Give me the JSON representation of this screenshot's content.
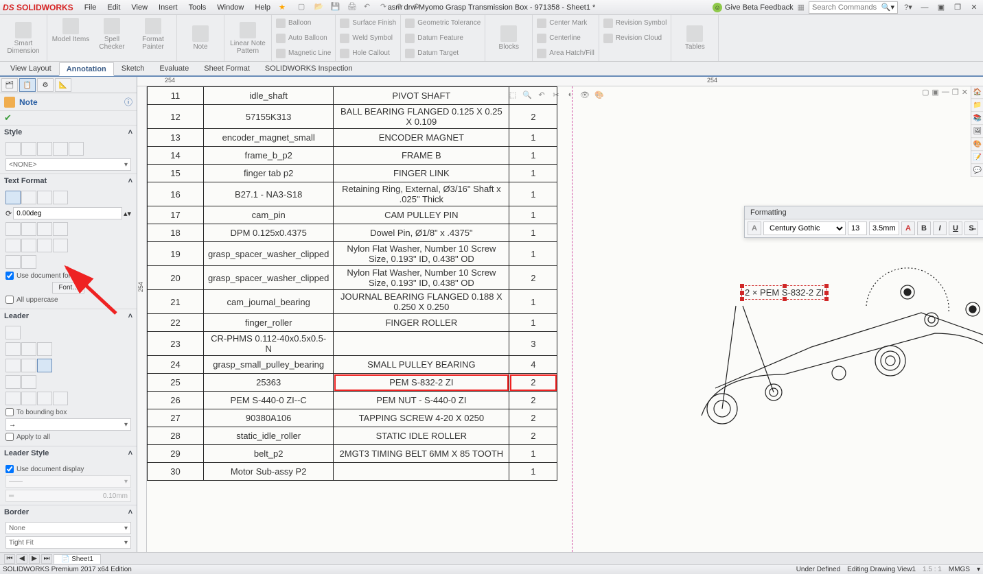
{
  "app": {
    "logo": "SOLIDWORKS"
  },
  "menubar": [
    "File",
    "Edit",
    "View",
    "Insert",
    "Tools",
    "Window",
    "Help"
  ],
  "doc_title": "asm drw-Myomo Grasp Transmission Box - 971358 - Sheet1 *",
  "beta_label": "Give Beta Feedback",
  "search_placeholder": "Search Commands",
  "ribbon": {
    "groups": [
      [
        "Smart Dimension"
      ],
      [
        "Model Items",
        "Spell Checker",
        "Format Painter"
      ],
      [
        "Note"
      ],
      [
        "Linear Note Pattern"
      ],
      [
        [
          "Balloon",
          "Auto Balloon",
          "Magnetic Line"
        ]
      ],
      [
        [
          "Surface Finish",
          "Weld Symbol",
          "Hole Callout"
        ]
      ],
      [
        [
          "Geometric Tolerance",
          "Datum Feature",
          "Datum Target"
        ]
      ],
      [
        "Blocks"
      ],
      [
        [
          "Center Mark",
          "Centerline",
          "Area Hatch/Fill"
        ]
      ],
      [
        [
          "Revision Symbol",
          "Revision Cloud",
          ""
        ]
      ],
      [
        "Tables"
      ]
    ]
  },
  "cmdtabs": [
    "View Layout",
    "Annotation",
    "Sketch",
    "Evaluate",
    "Sheet Format",
    "SOLIDWORKS Inspection"
  ],
  "cmdtabs_active": 1,
  "panel": {
    "note_label": "Note",
    "sections": {
      "style": "Style",
      "style_value": "<NONE>",
      "textformat": "Text Format",
      "angle": "0.00deg",
      "use_doc_font": "Use document font",
      "font_btn": "Font...",
      "all_upper": "All uppercase",
      "leader": "Leader",
      "to_bounding": "To bounding box",
      "apply_all": "Apply to all",
      "leader_style": "Leader Style",
      "use_doc_display": "Use document display",
      "thickness": "0.10mm",
      "border": "Border",
      "border_none": "None",
      "border_fit": "Tight Fit"
    }
  },
  "ruler_marks": {
    "top": "254",
    "left": "254"
  },
  "formatting": {
    "title": "Formatting",
    "font": "Century Gothic",
    "size": "13",
    "height": "3.5mm"
  },
  "note_text": "2 × PEM S-832-2 ZI",
  "bom_rows": [
    {
      "no": "11",
      "pn": "idle_shaft",
      "desc": "PIVOT SHAFT",
      "qty": ""
    },
    {
      "no": "12",
      "pn": "57155K313",
      "desc": "BALL BEARING FLANGED 0.125 X 0.25 X 0.109",
      "qty": "2"
    },
    {
      "no": "13",
      "pn": "encoder_magnet_small",
      "desc": "ENCODER MAGNET",
      "qty": "1"
    },
    {
      "no": "14",
      "pn": "frame_b_p2",
      "desc": "FRAME B",
      "qty": "1"
    },
    {
      "no": "15",
      "pn": "finger tab p2",
      "desc": "FINGER LINK",
      "qty": "1"
    },
    {
      "no": "16",
      "pn": "B27.1 - NA3-S18",
      "desc": "Retaining Ring, External, Ø3/16\" Shaft x .025\" Thick",
      "qty": "1"
    },
    {
      "no": "17",
      "pn": "cam_pin",
      "desc": "CAM PULLEY PIN",
      "qty": "1"
    },
    {
      "no": "18",
      "pn": "DPM 0.125x0.4375",
      "desc": "Dowel Pin, Ø1/8\" x .4375\"",
      "qty": "1"
    },
    {
      "no": "19",
      "pn": "grasp_spacer_washer_clipped",
      "desc": "Nylon Flat Washer, Number 10 Screw Size, 0.193\" ID, 0.438\" OD",
      "qty": "1"
    },
    {
      "no": "20",
      "pn": "grasp_spacer_washer_clipped",
      "desc": "Nylon Flat Washer, Number 10 Screw Size, 0.193\" ID, 0.438\" OD",
      "qty": "2"
    },
    {
      "no": "21",
      "pn": "cam_journal_bearing",
      "desc": "JOURNAL BEARING FLANGED 0.188 X 0.250 X 0.250",
      "qty": "1"
    },
    {
      "no": "22",
      "pn": "finger_roller",
      "desc": "FINGER ROLLER",
      "qty": "1"
    },
    {
      "no": "23",
      "pn": "CR-PHMS 0.112-40x0.5x0.5-N",
      "desc": "",
      "qty": "3"
    },
    {
      "no": "24",
      "pn": "grasp_small_pulley_bearing",
      "desc": "SMALL PULLEY BEARING",
      "qty": "4"
    },
    {
      "no": "25",
      "pn": "25363",
      "desc": "PEM S-832-2 ZI",
      "qty": "2",
      "hl": true
    },
    {
      "no": "26",
      "pn": "PEM S-440-0 ZI--C",
      "desc": "PEM NUT -  S-440-0 ZI",
      "qty": "2"
    },
    {
      "no": "27",
      "pn": "90380A106",
      "desc": "TAPPING SCREW 4-20 X 0250",
      "qty": "2"
    },
    {
      "no": "28",
      "pn": "static_idle_roller",
      "desc": "STATIC IDLE ROLLER",
      "qty": "2"
    },
    {
      "no": "29",
      "pn": "belt_p2",
      "desc": "2MGT3 TIMING BELT 6MM X 85 TOOTH",
      "qty": "1"
    },
    {
      "no": "30",
      "pn": "Motor Sub-assy P2",
      "desc": "",
      "qty": "1"
    }
  ],
  "sheet_tab": "Sheet1",
  "status": {
    "edition": "SOLIDWORKS Premium 2017 x64 Edition",
    "defined": "Under Defined",
    "mode": "Editing Drawing View1",
    "scale": "1.5 : 1",
    "units": "MMGS"
  }
}
